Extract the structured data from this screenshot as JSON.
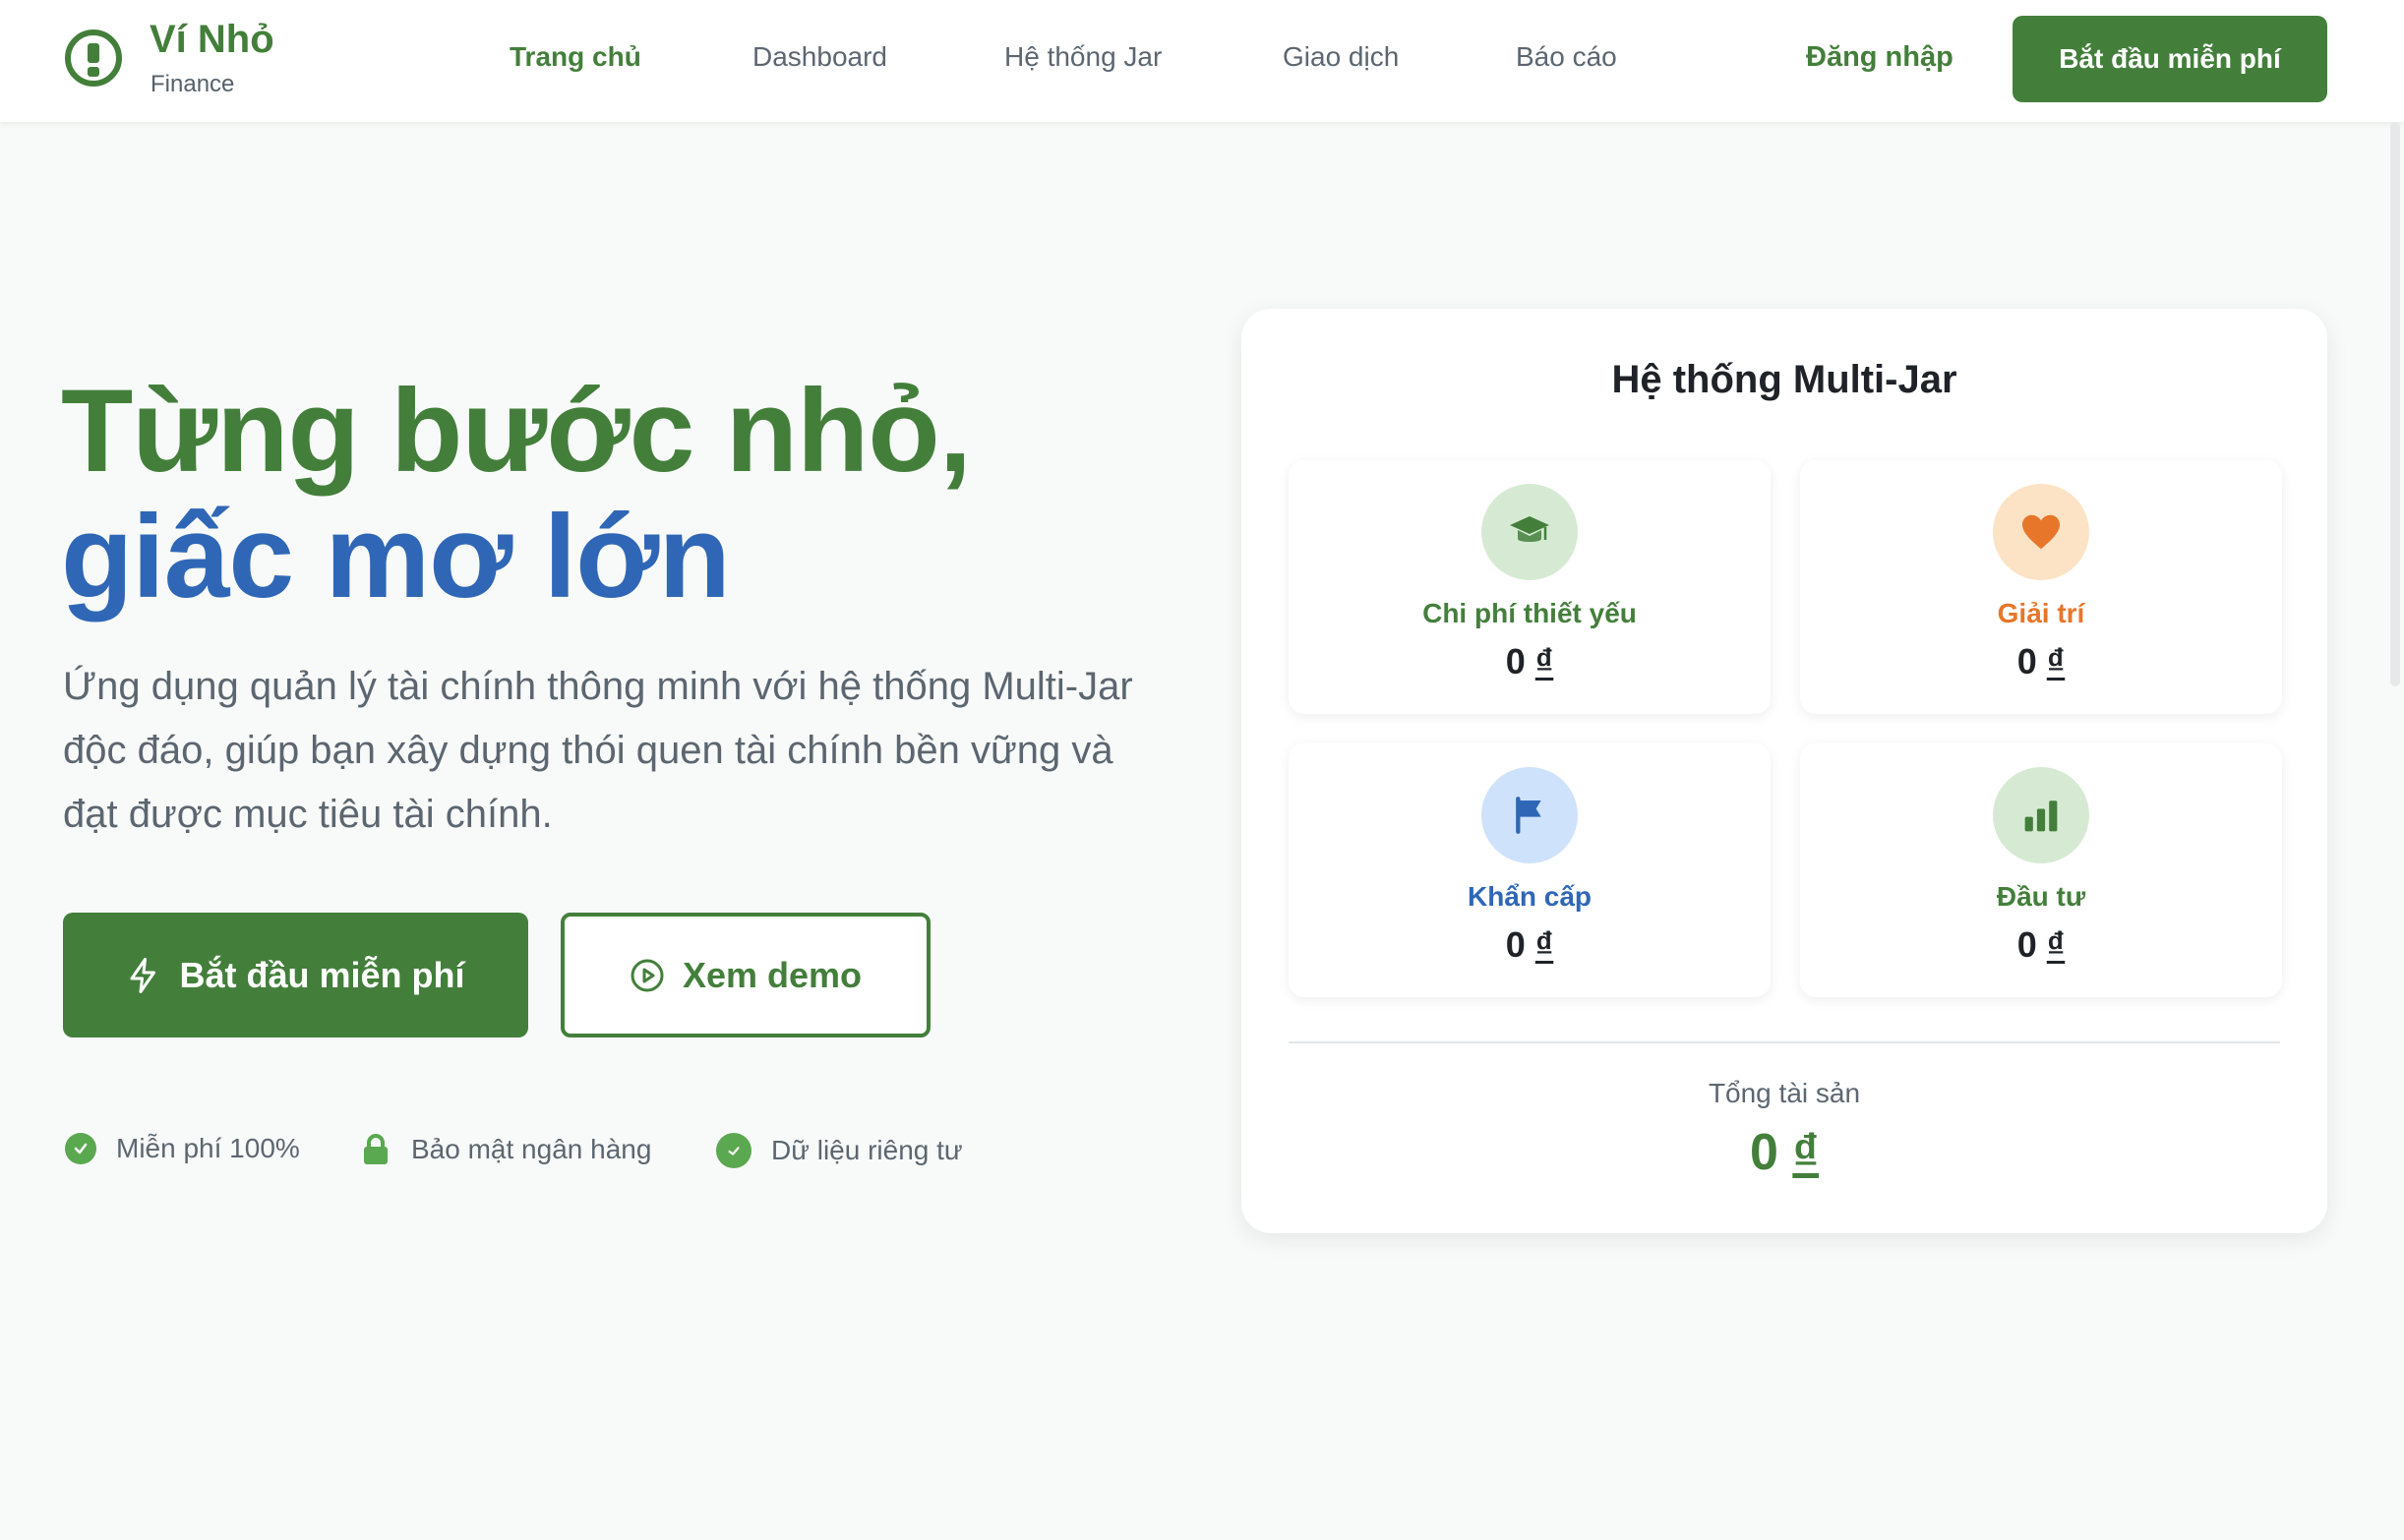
{
  "brand": {
    "name": "Ví Nhỏ",
    "subtitle": "Finance"
  },
  "nav": [
    {
      "label": "Trang chủ",
      "active": true
    },
    {
      "label": "Dashboard"
    },
    {
      "label": "Hệ thống Jar"
    },
    {
      "label": "Giao dịch"
    },
    {
      "label": "Báo cáo"
    }
  ],
  "header": {
    "login_label": "Đăng nhập",
    "cta_label": "Bắt đầu miễn phí"
  },
  "hero": {
    "title_line1": "Từng bước nhỏ,",
    "title_line2": "giấc mơ lớn",
    "description": "Ứng dụng quản lý tài chính thông minh với hệ thống Multi-Jar độc đáo, giúp bạn xây dựng thói quen tài chính bền vững và đạt được mục tiêu tài chính.",
    "primary_button": "Bắt đầu miễn phí",
    "secondary_button": "Xem demo",
    "trust": [
      {
        "label": "Miễn phí 100%",
        "icon": "check-circle-icon"
      },
      {
        "label": "Bảo mật ngân hàng",
        "icon": "lock-icon"
      },
      {
        "label": "Dữ liệu riêng tư",
        "icon": "shield-check-icon"
      }
    ]
  },
  "jar_card": {
    "title": "Hệ thống Multi-Jar",
    "jars": [
      {
        "label": "Chi phí thiết yếu",
        "amount": "0",
        "currency": "₫",
        "icon": "graduation-cap-icon",
        "color": "#437f3b",
        "bg": "#d6ead3"
      },
      {
        "label": "Giải trí",
        "amount": "0",
        "currency": "₫",
        "icon": "heart-icon",
        "color": "#e8762a",
        "bg": "#fce3c5"
      },
      {
        "label": "Khẩn cấp",
        "amount": "0",
        "currency": "₫",
        "icon": "flag-icon",
        "color": "#2f67b6",
        "bg": "#cfe2fb"
      },
      {
        "label": "Đầu tư",
        "amount": "0",
        "currency": "₫",
        "icon": "bar-chart-icon",
        "color": "#437f3b",
        "bg": "#d6ead3"
      }
    ],
    "total_label": "Tổng tài sản",
    "total_amount": "0",
    "total_currency": "₫"
  }
}
